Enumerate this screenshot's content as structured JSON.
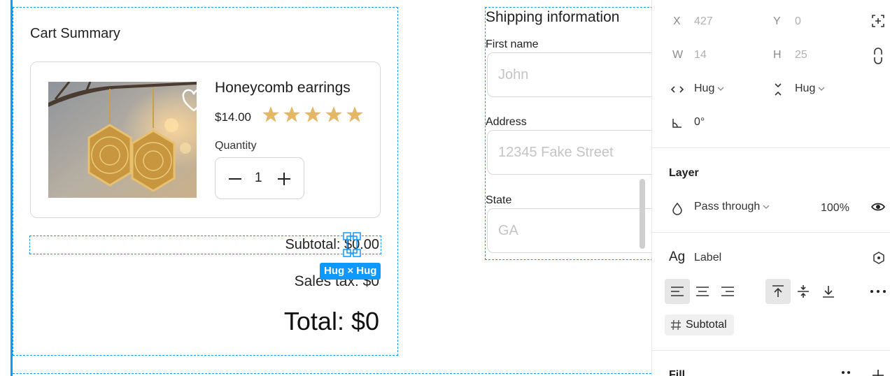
{
  "cart": {
    "title": "Cart Summary",
    "product_name": "Honeycomb earrings",
    "price": "$14.00",
    "rating": 5,
    "quantity_label": "Quantity",
    "quantity": "1",
    "subtotal": "Subtotal: $0.00",
    "sales_tax": "Sales tax: $0",
    "total": "Total: $0"
  },
  "selection": {
    "badge": "Hug × Hug",
    "color": "#0d99ff"
  },
  "shipping": {
    "title": "Shipping information",
    "fields": [
      {
        "label": "First name",
        "placeholder": "John"
      },
      {
        "label": "Address",
        "placeholder": "12345 Fake Street"
      },
      {
        "label": "State",
        "placeholder": "GA"
      }
    ]
  },
  "panel": {
    "x_label": "X",
    "x_value": "427",
    "y_label": "Y",
    "y_value": "0",
    "w_label": "W",
    "w_value": "14",
    "h_label": "H",
    "h_value": "25",
    "width_mode": "Hug",
    "height_mode": "Hug",
    "rotation": "0°",
    "layer_title": "Layer",
    "blend_mode": "Pass through",
    "opacity": "100%",
    "text_style_prefix": "Ag",
    "text_style_name": "Label",
    "variable_chip": "Subtotal",
    "fill_title": "Fill"
  },
  "colors": {
    "accent": "#0d99ff",
    "star": "#e4b866"
  }
}
